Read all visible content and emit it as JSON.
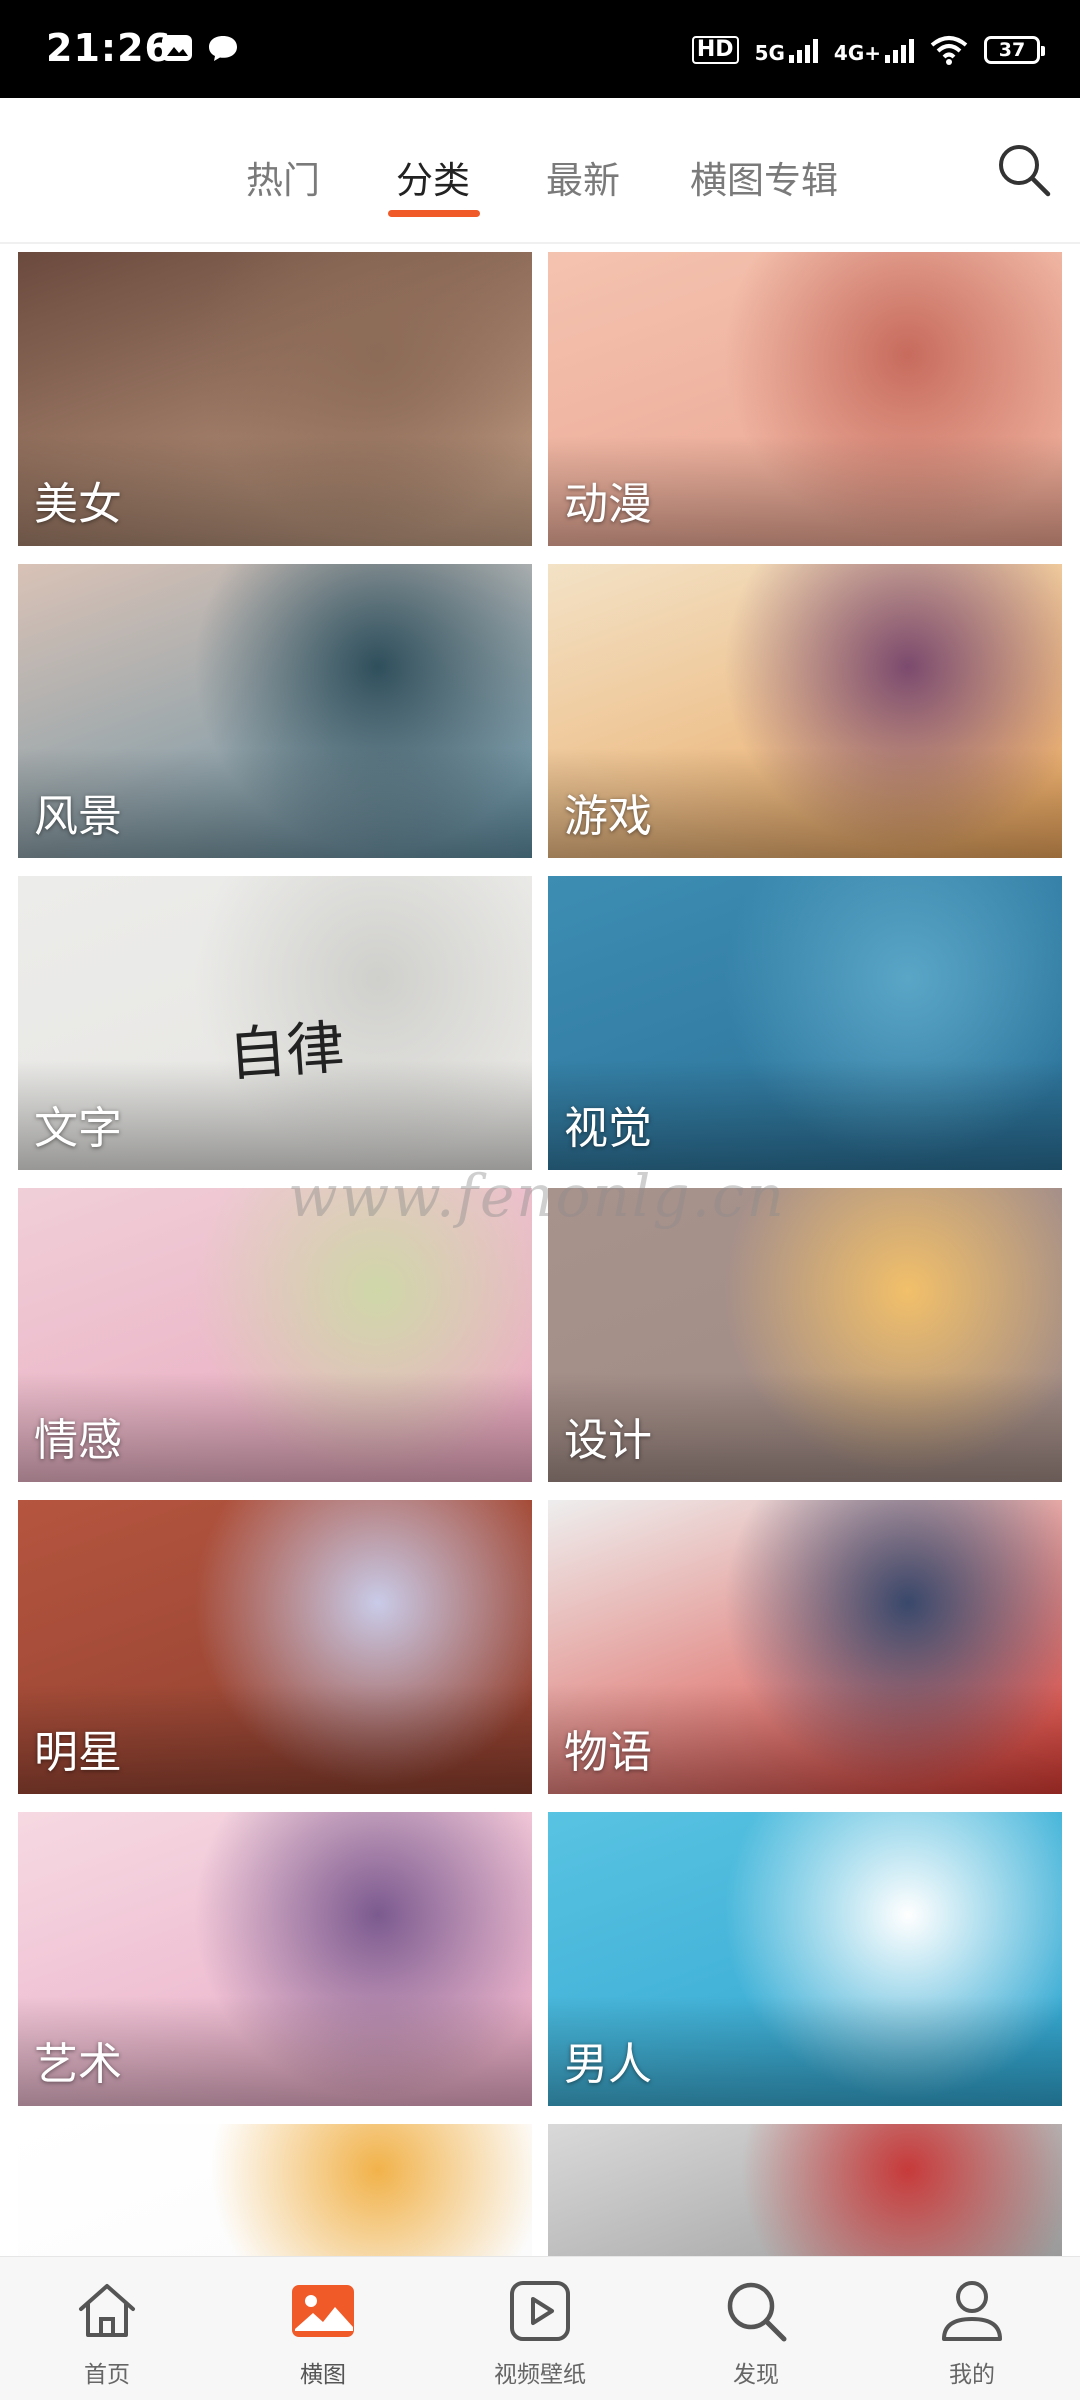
{
  "status_bar": {
    "time": "21:26",
    "network_hd": "HD",
    "network_5g": "5G",
    "network_4g": "4G+",
    "battery": "37"
  },
  "tabs": [
    {
      "label": "热门"
    },
    {
      "label": "分类",
      "active": true
    },
    {
      "label": "最新"
    },
    {
      "label": "横图专辑"
    }
  ],
  "categories": [
    {
      "label": "美女",
      "thumb_colors": [
        "#6b4a3e",
        "#c9a489",
        "#8c6b57"
      ]
    },
    {
      "label": "动漫",
      "thumb_colors": [
        "#f4c3b0",
        "#e9a28e",
        "#c76b5d"
      ]
    },
    {
      "label": "风景",
      "thumb_colors": [
        "#d9c2b6",
        "#5e8da2",
        "#2f4f5c"
      ]
    },
    {
      "label": "游戏",
      "thumb_colors": [
        "#f3e2c6",
        "#e9a35a",
        "#7b4a6e"
      ]
    },
    {
      "label": "文字",
      "thumb_colors": [
        "#ececea",
        "#e6e5e2",
        "#cfcfcc"
      ],
      "handwriting": "自律"
    },
    {
      "label": "视觉",
      "thumb_colors": [
        "#3d8db3",
        "#2a6f96",
        "#5aa6c7"
      ]
    },
    {
      "label": "情感",
      "thumb_colors": [
        "#f0cfd8",
        "#e9a6bd",
        "#cfd7a8"
      ]
    },
    {
      "label": "设计",
      "thumb_colors": [
        "#a8928c",
        "#a08a84",
        "#f2c06a"
      ]
    },
    {
      "label": "明星",
      "thumb_colors": [
        "#b5553f",
        "#8c3e2e",
        "#c9cbe8"
      ]
    },
    {
      "label": "物语",
      "thumb_colors": [
        "#eeeeee",
        "#d93a32",
        "#39486b"
      ]
    },
    {
      "label": "艺术",
      "thumb_colors": [
        "#f6d9e2",
        "#e8a8c4",
        "#7b5a8f"
      ]
    },
    {
      "label": "男人",
      "thumb_colors": [
        "#59c3e2",
        "#2fa4cf",
        "#ffffff"
      ]
    },
    {
      "label": "",
      "thumb_colors": [
        "#ffffff",
        "#fbfbfb",
        "#f1b24a"
      ]
    },
    {
      "label": "",
      "thumb_colors": [
        "#d9d9d9",
        "#9a9a9a",
        "#c73a3a"
      ]
    }
  ],
  "watermark": "www.fenonlg.cn",
  "bottom_nav": [
    {
      "label": "首页",
      "icon": "home-icon"
    },
    {
      "label": "横图",
      "icon": "image-icon",
      "active": true
    },
    {
      "label": "视频壁纸",
      "icon": "video-play-icon"
    },
    {
      "label": "发现",
      "icon": "discover-search-icon"
    },
    {
      "label": "我的",
      "icon": "profile-icon"
    }
  ],
  "colors": {
    "accent": "#f05a28",
    "status_bar_bg": "#000000",
    "tab_active": "#222222",
    "tab_inactive": "#7a7a7a",
    "nav_bg": "#f7f7f7"
  }
}
